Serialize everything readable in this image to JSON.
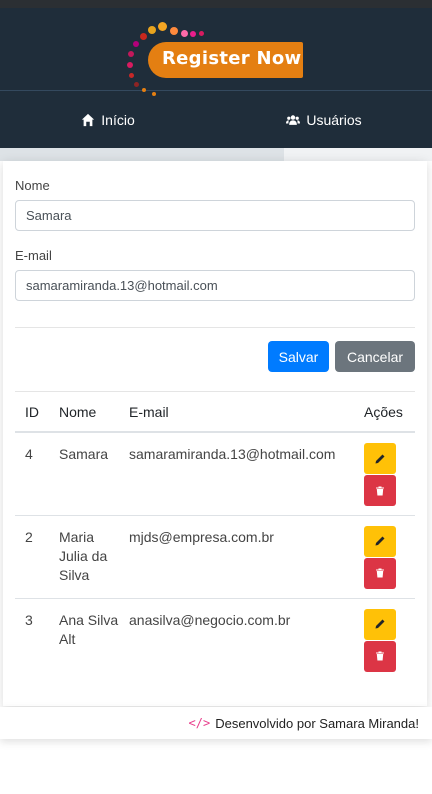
{
  "logo": {
    "text": "Register Now"
  },
  "nav": {
    "items": [
      {
        "icon": "home-icon",
        "label": "Início"
      },
      {
        "icon": "users-icon",
        "label": "Usuários"
      }
    ]
  },
  "form": {
    "name_label": "Nome",
    "name_value": "Samara",
    "email_label": "E-mail",
    "email_value": "samaramiranda.13@hotmail.com",
    "save_label": "Salvar",
    "cancel_label": "Cancelar"
  },
  "table": {
    "headers": [
      "ID",
      "Nome",
      "E-mail",
      "Ações"
    ],
    "rows": [
      {
        "id": "4",
        "name": "Samara",
        "email": "samaramiranda.13@hotmail.com"
      },
      {
        "id": "2",
        "name": "Maria Julia da Silva",
        "email": "mjds@empresa.com.br"
      },
      {
        "id": "3",
        "name": "Ana Silva Alt",
        "email": "anasilva@negocio.com.br"
      }
    ]
  },
  "footer": {
    "text": "Desenvolvido por Samara Miranda!"
  },
  "colors": {
    "header_bg": "#1f2d3a",
    "logo_orange": "#e47f12",
    "primary": "#007bff",
    "secondary": "#6c757d",
    "warning": "#ffc107",
    "danger": "#dc3545"
  }
}
